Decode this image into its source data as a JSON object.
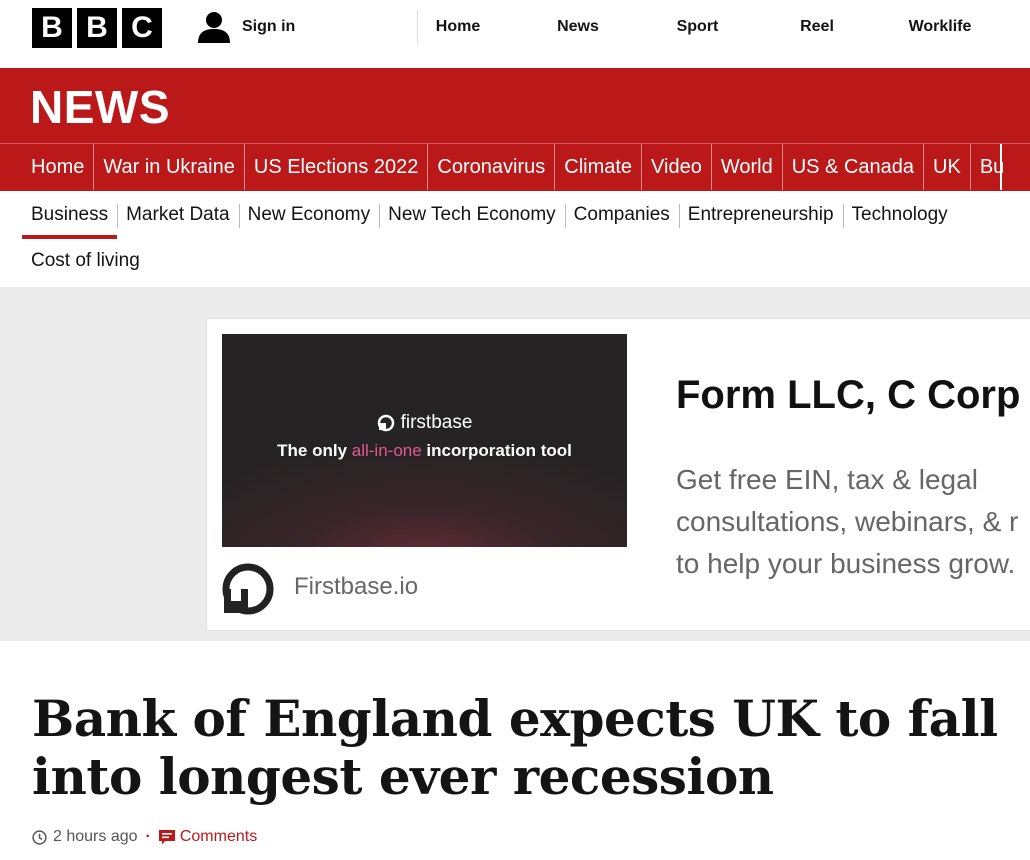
{
  "top_bar": {
    "logo_letters": [
      "B",
      "B",
      "C"
    ],
    "sign_in": "Sign in",
    "nav": [
      "Home",
      "News",
      "Sport",
      "Reel",
      "Worklife"
    ]
  },
  "news_banner": {
    "title": "NEWS",
    "nav": [
      "Home",
      "War in Ukraine",
      "US Elections 2022",
      "Coronavirus",
      "Climate",
      "Video",
      "World",
      "US & Canada",
      "UK",
      "Bu"
    ]
  },
  "business_nav": {
    "items": [
      "Business",
      "Market Data",
      "New Economy",
      "New Tech Economy",
      "Companies",
      "Entrepreneurship",
      "Technology"
    ],
    "active": "Business",
    "second_row": "Cost of living"
  },
  "ad": {
    "brand": "firstbase",
    "tagline_pre": "The only ",
    "tagline_highlight": "all-in-one",
    "tagline_post": " incorporation tool",
    "domain": "Firstbase.io",
    "headline": "Form LLC, C Corp",
    "body_lines": [
      "Get free EIN, tax & legal",
      "consultations, webinars, & r",
      "to help your business grow."
    ]
  },
  "article": {
    "headline": "Bank of England expects UK to fall into longest ever recession",
    "timestamp": "2 hours ago",
    "comments_label": "Comments"
  },
  "colors": {
    "brand_red": "#bb1919",
    "pink_highlight": "#e05a91"
  }
}
